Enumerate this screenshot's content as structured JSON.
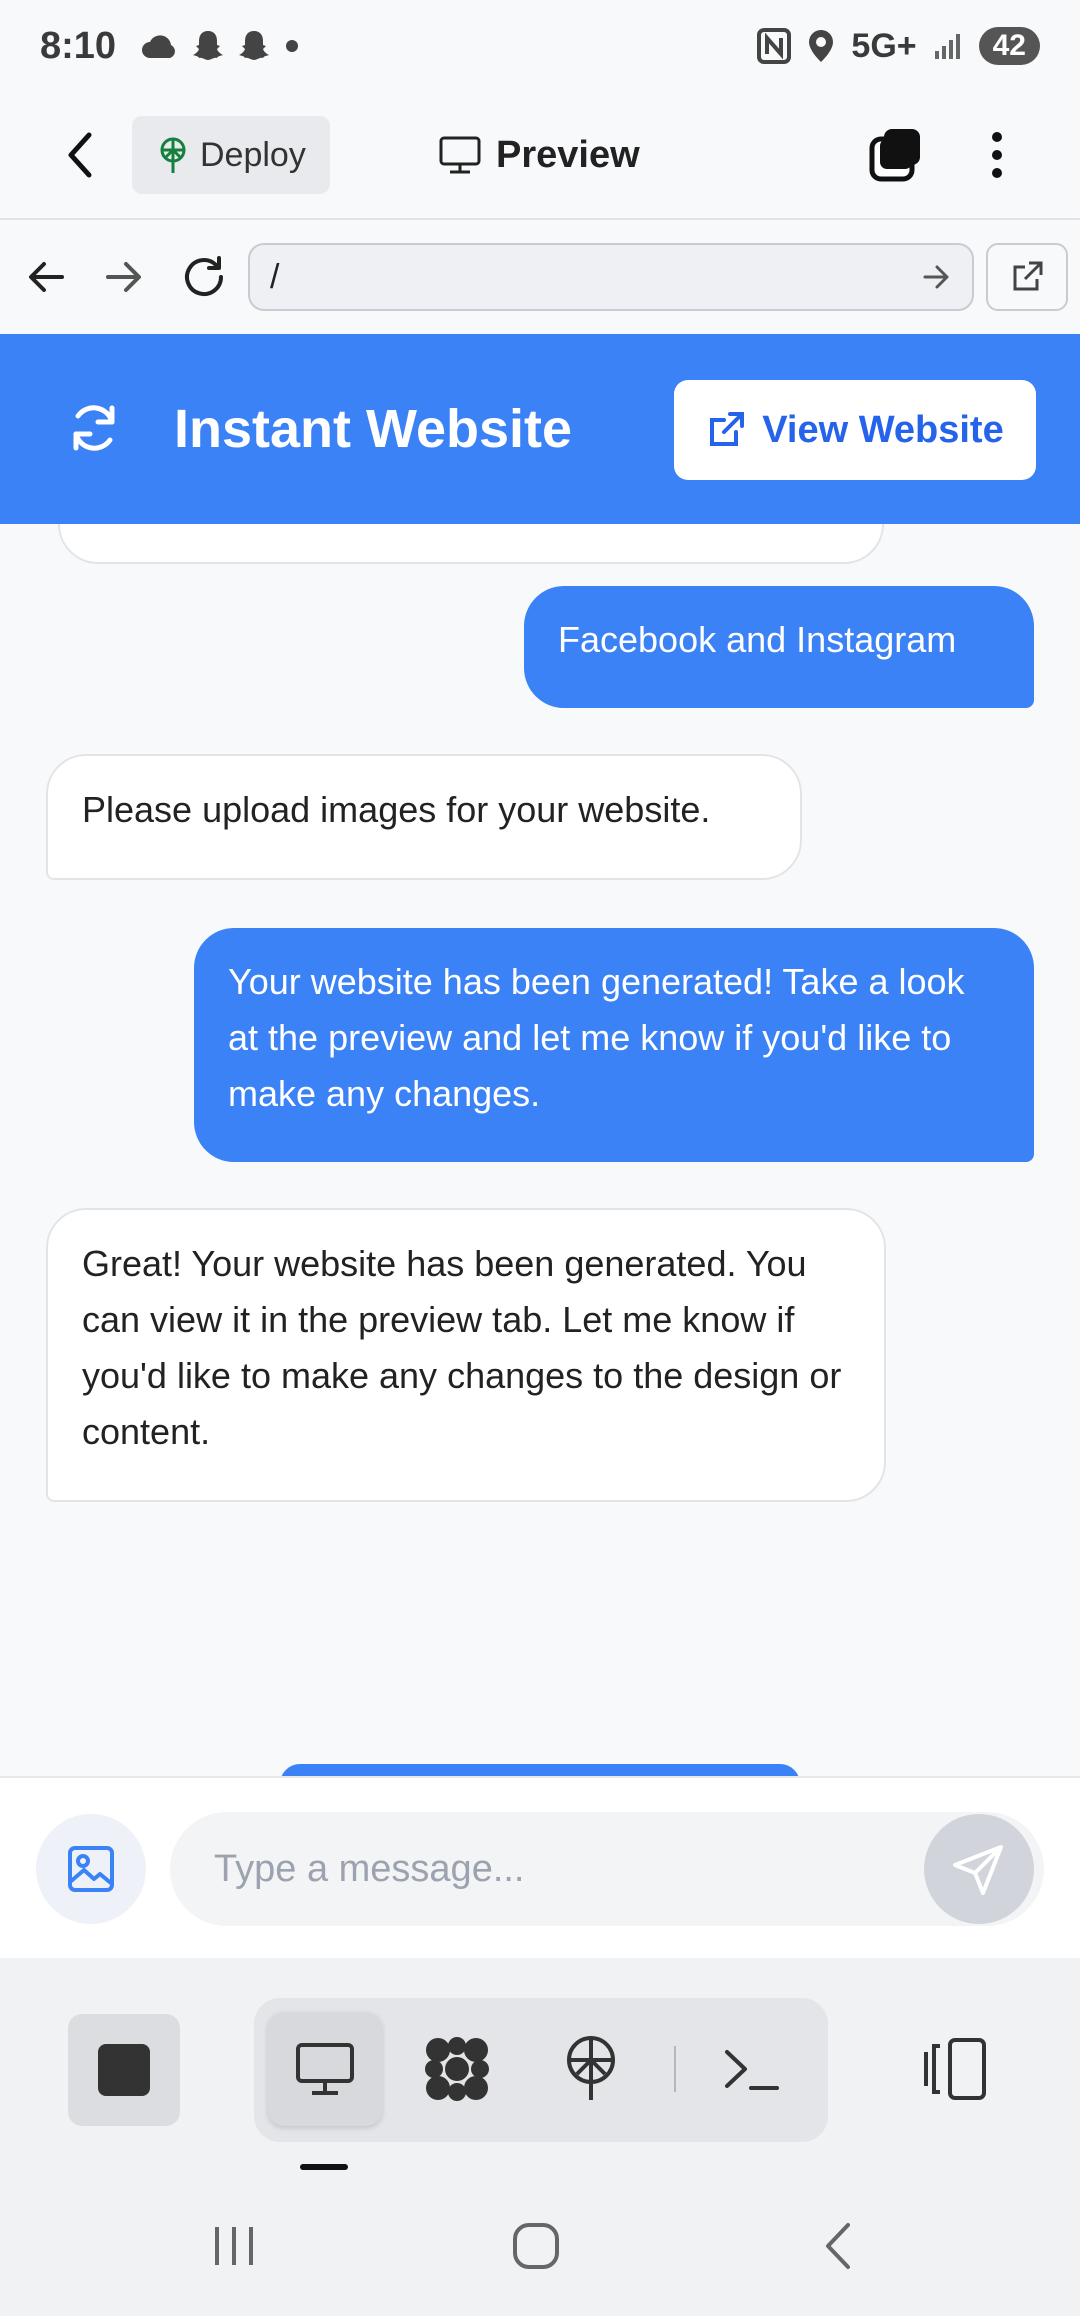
{
  "status_bar": {
    "time": "8:10",
    "network": "5G+",
    "battery": "42"
  },
  "topbar": {
    "deploy_label": "Deploy",
    "preview_label": "Preview"
  },
  "browser": {
    "url": "/"
  },
  "site": {
    "title": "Instant Website",
    "view_button": "View Website",
    "accent_color": "#3b82f6"
  },
  "chat": {
    "messages": [
      {
        "role": "user",
        "text": "Facebook and Instagram"
      },
      {
        "role": "assistant",
        "text": "Please upload images for your website."
      },
      {
        "role": "user",
        "text": "Your website has been generated! Take a look at the preview and let me know if you'd like to make any changes."
      },
      {
        "role": "assistant",
        "text": "Great! Your website has been generated. You can view it in the preview tab. Let me know if you'd like to make any changes to the design or content."
      }
    ]
  },
  "composer": {
    "placeholder": "Type a message..."
  },
  "toolbar": {
    "tools": [
      "monitor-icon",
      "grid-dots-icon",
      "globe-arrow-icon",
      "terminal-icon"
    ],
    "active_tool": "monitor-icon"
  }
}
